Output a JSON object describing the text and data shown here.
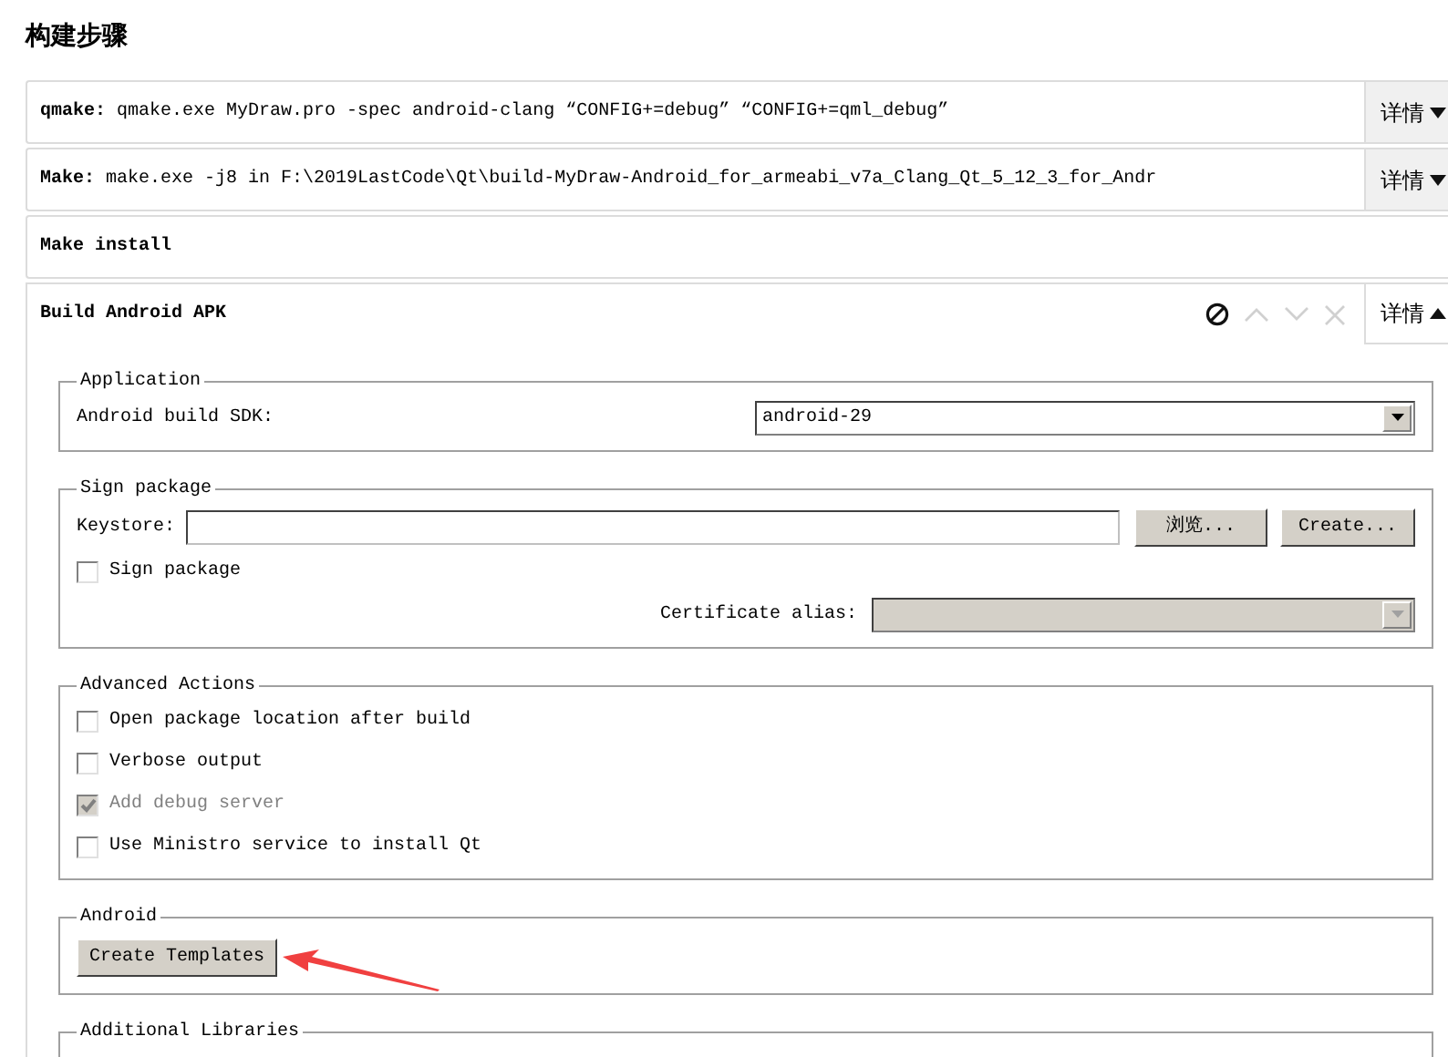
{
  "heading": "构建步骤",
  "steps": [
    {
      "label": "qmake:",
      "command": "qmake.exe MyDraw.pro -spec android-clang “CONFIG+=debug” “CONFIG+=qml_debug”",
      "details": "详情",
      "expanded": false
    },
    {
      "label": "Make:",
      "command": "make.exe -j8 in F:\\2019LastCode\\Qt\\build-MyDraw-Android_for_armeabi_v7a_Clang_Qt_5_12_3_for_Andr",
      "details": "详情",
      "expanded": false
    },
    {
      "label": "Make install",
      "expanded": false
    },
    {
      "label": "Build Android APK",
      "details": "详情",
      "expanded": true
    }
  ],
  "groups": [
    {
      "title": "Application",
      "rows": [
        {
          "kind": "combo",
          "label": "Android build SDK:",
          "value": "android-29",
          "disabled": false
        }
      ]
    },
    {
      "title": "Sign package",
      "rows": [
        {
          "kind": "file",
          "label": "Keystore:",
          "buttons": [
            "浏览...",
            "Create..."
          ]
        },
        {
          "kind": "checkbox",
          "label": "Sign package",
          "checked": false,
          "disabled": false
        },
        {
          "kind": "side-combo",
          "label": "Certificate alias:",
          "disabled": true
        }
      ]
    },
    {
      "title": "Advanced Actions",
      "rows": [
        {
          "kind": "checkbox",
          "label": "Open package location after build",
          "checked": false,
          "disabled": false
        },
        {
          "kind": "checkbox",
          "label": "Verbose output",
          "checked": false,
          "disabled": false
        },
        {
          "kind": "checkbox",
          "label": "Add debug server",
          "checked": true,
          "disabled": true
        },
        {
          "kind": "checkbox",
          "label": "Use Ministro service to install Qt",
          "checked": false,
          "disabled": false
        }
      ]
    },
    {
      "title": "Android",
      "rows": [
        {
          "kind": "button",
          "label": "Create Templates"
        }
      ]
    },
    {
      "title": "Additional Libraries"
    }
  ]
}
